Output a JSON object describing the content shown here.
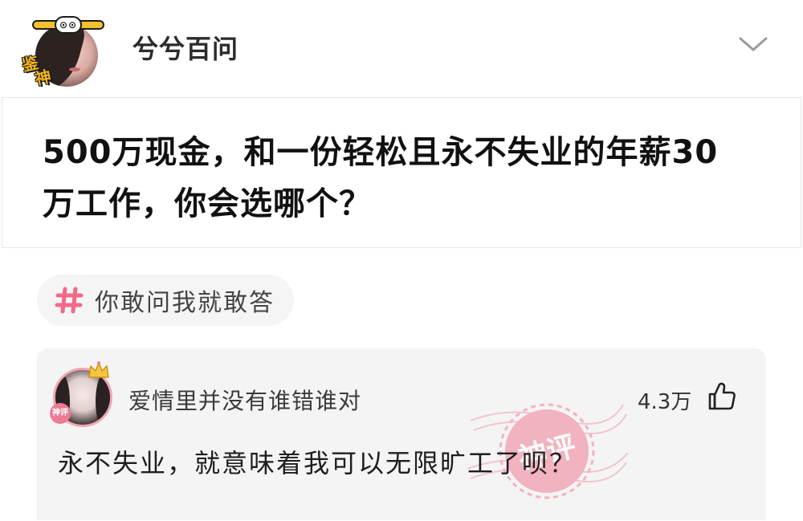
{
  "header": {
    "author_name": "兮兮百问",
    "avatar_badge": [
      "鉴",
      "神"
    ],
    "headband_eyes": "⊙⊙"
  },
  "question": {
    "text": "500万现金，和一份轻松且永不失业的年薪30万工作，你会选哪个？"
  },
  "topic": {
    "label": "你敢问我就敢答",
    "icon": "hash-icon",
    "accent_color": "#f06a8a"
  },
  "comment": {
    "author_name": "爱情里并没有谁错谁对",
    "like_count": "4.3万",
    "text": "永不失业，就意味着我可以无限旷工了呗？",
    "stamp_label": "神评",
    "avatar_seal": "神评"
  },
  "colors": {
    "accent_pink": "#f06a8a",
    "card_bg": "#f4f4f4",
    "badge_yellow": "#f2c12e"
  }
}
